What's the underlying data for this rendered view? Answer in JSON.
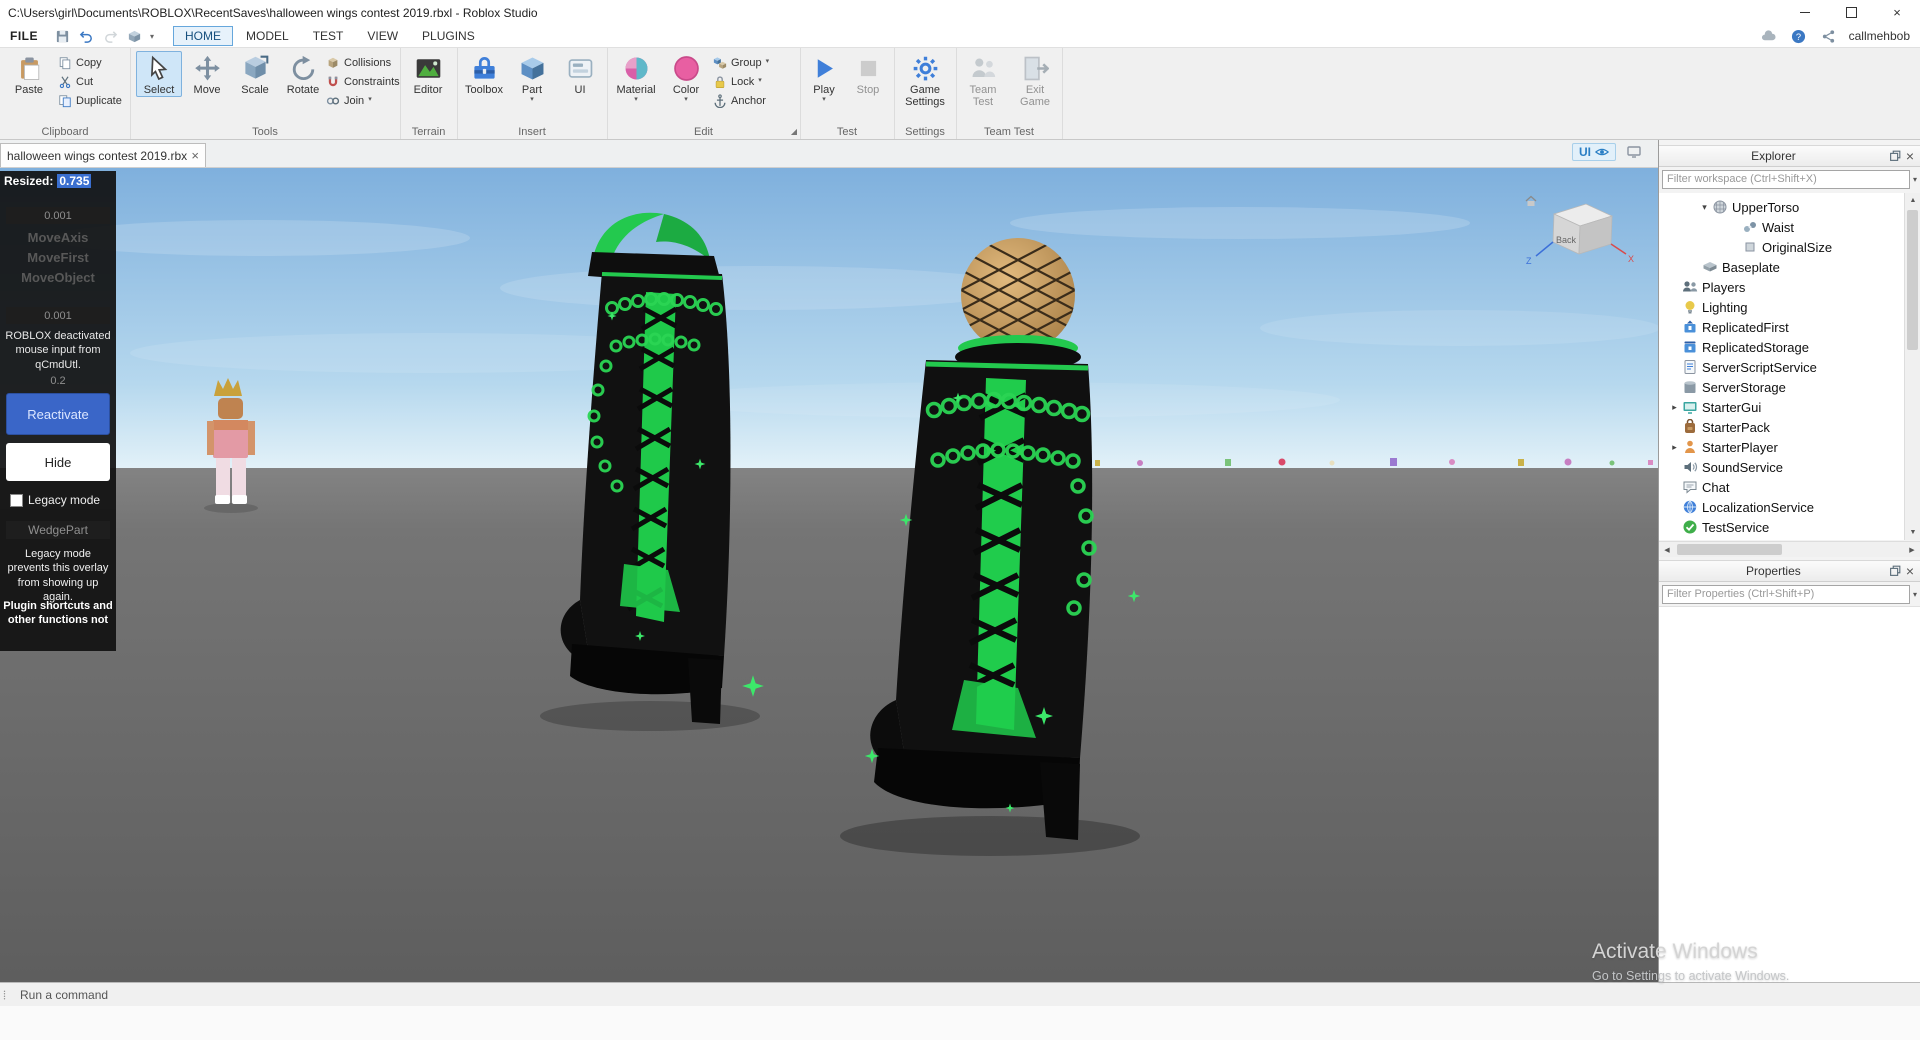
{
  "window": {
    "title": "C:\\Users\\girl\\Documents\\ROBLOX\\RecentSaves\\halloween wings contest 2019.rbxl - Roblox Studio"
  },
  "menubar": {
    "file_label": "FILE",
    "tabs": [
      "HOME",
      "MODEL",
      "TEST",
      "VIEW",
      "PLUGINS"
    ],
    "active_tab": "HOME",
    "username": "callmehbob"
  },
  "ribbon": {
    "clipboard": {
      "group_label": "Clipboard",
      "paste": "Paste",
      "copy": "Copy",
      "cut": "Cut",
      "duplicate": "Duplicate"
    },
    "tools": {
      "group_label": "Tools",
      "select": "Select",
      "move": "Move",
      "scale": "Scale",
      "rotate": "Rotate",
      "collisions": "Collisions",
      "constraints": "Constraints",
      "join": "Join"
    },
    "terrain": {
      "group_label": "Terrain",
      "editor": "Editor"
    },
    "insert": {
      "group_label": "Insert",
      "toolbox": "Toolbox",
      "part": "Part",
      "ui": "UI"
    },
    "edit": {
      "group_label": "Edit",
      "material": "Material",
      "color": "Color",
      "group": "Group",
      "lock": "Lock",
      "anchor": "Anchor"
    },
    "test": {
      "group_label": "Test",
      "play": "Play",
      "stop": "Stop"
    },
    "settings": {
      "group_label": "Settings",
      "game_settings": "Game Settings"
    },
    "team_test": {
      "group_label": "Team Test",
      "team_test": "Team Test",
      "exit_game": "Exit Game"
    }
  },
  "document_tab": {
    "title": "halloween wings contest 2019.rbxl",
    "close": "×",
    "ui_toggle": "UI"
  },
  "viewport": {
    "resized_prefix": "Resized:",
    "resized_value": "0.735",
    "view_cube_label": "Back",
    "axis_x": "X",
    "axis_z": "Z",
    "watermark_title": "Activate Windows",
    "watermark_subtitle": "Go to Settings to activate Windows."
  },
  "plugin_overlay": {
    "value_top": "0.001",
    "menu_items": [
      "MoveAxis",
      "MoveFirst",
      "MoveObject"
    ],
    "value_mid": "0.001",
    "deactivated_message": "ROBLOX deactivated mouse input from qCmdUtl.",
    "value_small": "0.2",
    "reactivate_label": "Reactivate",
    "hide_label": "Hide",
    "legacy_checkbox_label": "Legacy mode",
    "wedge_label": "WedgePart",
    "legacy_note": "Legacy mode prevents this overlay from showing up again.",
    "shortcuts_note": "Plugin shortcuts and other functions not"
  },
  "explorer": {
    "title": "Explorer",
    "filter_placeholder": "Filter workspace (Ctrl+Shift+X)",
    "tree": [
      {
        "label": "UpperTorso",
        "icon": "mesh",
        "arrow": "down",
        "indent": 38
      },
      {
        "label": "Waist",
        "icon": "waist",
        "arrow": null,
        "indent": 68
      },
      {
        "label": "OriginalSize",
        "icon": "value",
        "arrow": null,
        "indent": 68
      },
      {
        "label": "Baseplate",
        "icon": "baseplate",
        "arrow": null,
        "indent": 28
      },
      {
        "label": "Players",
        "icon": "players",
        "arrow": null,
        "indent": 8
      },
      {
        "label": "Lighting",
        "icon": "lighting",
        "arrow": null,
        "indent": 8
      },
      {
        "label": "ReplicatedFirst",
        "icon": "replicatedfirst",
        "arrow": null,
        "indent": 8
      },
      {
        "label": "ReplicatedStorage",
        "icon": "replicatedstorage",
        "arrow": null,
        "indent": 8
      },
      {
        "label": "ServerScriptService",
        "icon": "serverscript",
        "arrow": null,
        "indent": 8
      },
      {
        "label": "ServerStorage",
        "icon": "serverstorage",
        "arrow": null,
        "indent": 8
      },
      {
        "label": "StarterGui",
        "icon": "startergui",
        "arrow": "right",
        "indent": 8
      },
      {
        "label": "StarterPack",
        "icon": "starterpack",
        "arrow": null,
        "indent": 8
      },
      {
        "label": "StarterPlayer",
        "icon": "starterplayer",
        "arrow": "right",
        "indent": 8
      },
      {
        "label": "SoundService",
        "icon": "sound",
        "arrow": null,
        "indent": 8
      },
      {
        "label": "Chat",
        "icon": "chat",
        "arrow": null,
        "indent": 8
      },
      {
        "label": "LocalizationService",
        "icon": "localization",
        "arrow": null,
        "indent": 8
      },
      {
        "label": "TestService",
        "icon": "testservice",
        "arrow": null,
        "indent": 8
      }
    ]
  },
  "properties": {
    "title": "Properties",
    "filter_placeholder": "Filter Properties (Ctrl+Shift+P)"
  },
  "command_bar": {
    "placeholder": "Run a command"
  },
  "colors": {
    "accent_green": "#23c94e",
    "boot_black": "#0d0d0d",
    "reactivate_blue": "#3a66c8",
    "sky_top": "#7fb0dd",
    "ground_gray": "#6f6f6f"
  }
}
